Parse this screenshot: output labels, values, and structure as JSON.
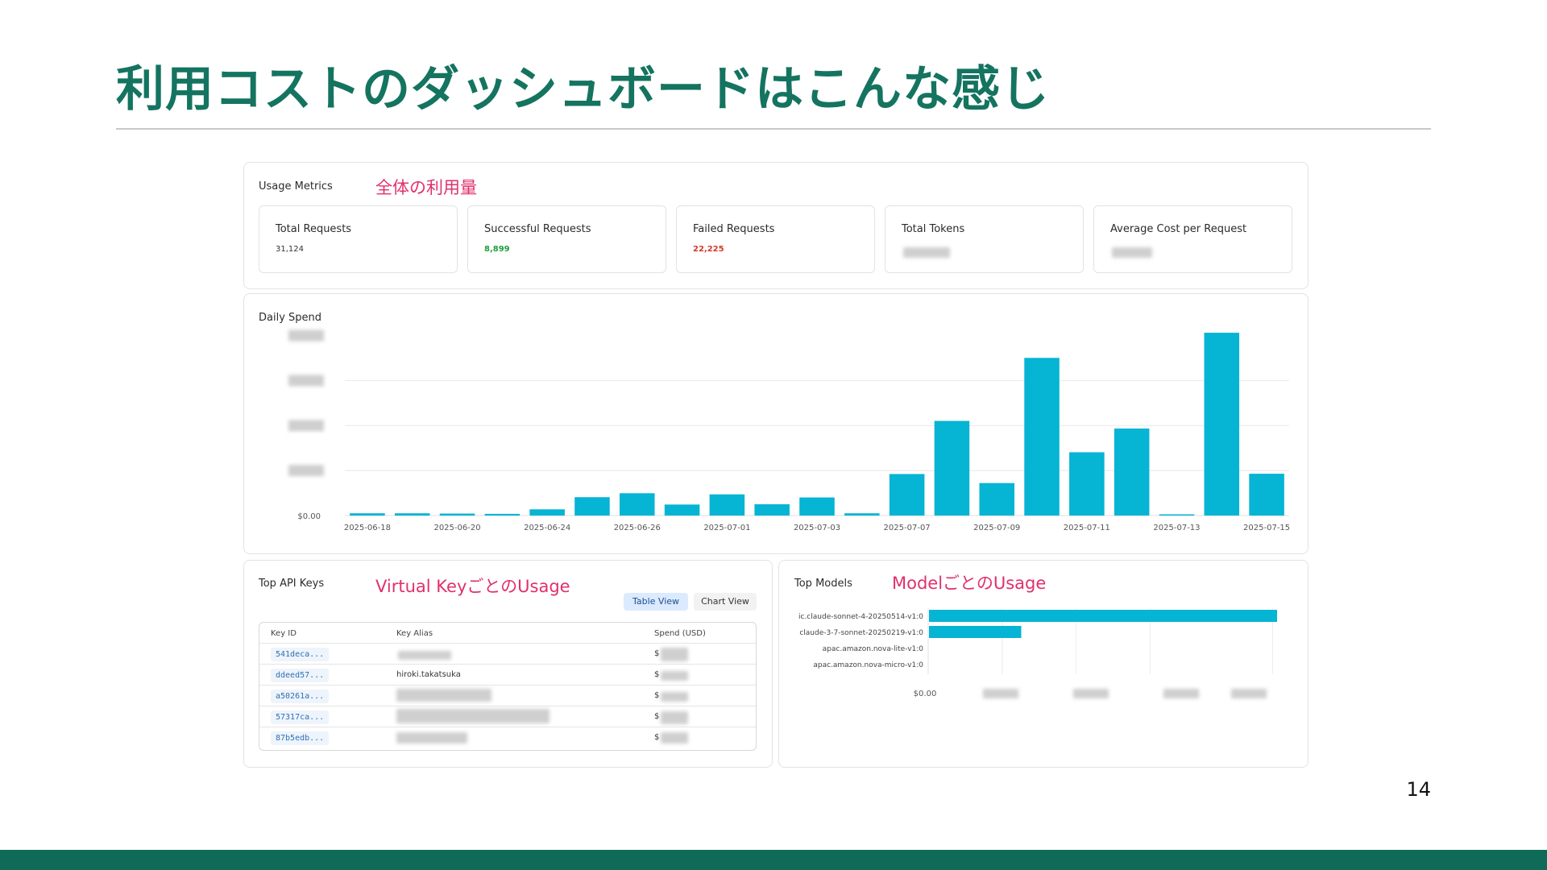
{
  "slide": {
    "title": "利用コストのダッシュボードはこんな感じ",
    "page_number": "14"
  },
  "colors": {
    "title": "#147460",
    "annotation": "#e1306c",
    "bar": "#06b4d4",
    "success": "#1f9d3a",
    "failed": "#d23a2a",
    "footer": "#0f6b58"
  },
  "usage_metrics": {
    "title": "Usage Metrics",
    "annotation": "全体の利用量",
    "cards": [
      {
        "label": "Total Requests",
        "value": "31,124",
        "tone": "neutral",
        "redacted": false
      },
      {
        "label": "Successful Requests",
        "value": "8,899",
        "tone": "success",
        "redacted": false
      },
      {
        "label": "Failed Requests",
        "value": "22,225",
        "tone": "failed",
        "redacted": false
      },
      {
        "label": "Total Tokens",
        "value": "",
        "tone": "neutral",
        "redacted": true
      },
      {
        "label": "Average Cost per Request",
        "value": "",
        "tone": "neutral",
        "redacted": true
      }
    ]
  },
  "daily_spend": {
    "title": "Daily Spend",
    "y_zero_label": "$0.00",
    "y_labels_redacted": true,
    "x_tick_labels": [
      "2025-06-18",
      "2025-06-20",
      "2025-06-24",
      "2025-06-26",
      "2025-07-01",
      "2025-07-03",
      "2025-07-07",
      "2025-07-09",
      "2025-07-11",
      "2025-07-13",
      "2025-07-15"
    ]
  },
  "chart_data": [
    {
      "type": "bar",
      "title": "Daily Spend",
      "x": [
        "2025-06-18",
        "2025-06-19",
        "2025-06-20",
        "2025-06-21",
        "2025-06-24",
        "2025-06-25",
        "2025-06-26",
        "2025-06-27",
        "2025-07-01",
        "2025-07-02",
        "2025-07-03",
        "2025-07-04",
        "2025-07-07",
        "2025-07-08",
        "2025-07-09",
        "2025-07-10",
        "2025-07-11",
        "2025-07-12",
        "2025-07-13",
        "2025-07-14",
        "2025-07-15"
      ],
      "values": [
        0.8,
        0.8,
        0.7,
        0.6,
        2.2,
        6.5,
        7.9,
        3.9,
        7.5,
        4.0,
        6.4,
        0.8,
        14.7,
        33.5,
        11.5,
        55.8,
        22.4,
        30.8,
        0.3,
        64.7,
        14.8
      ],
      "value_unit": "relative (y-axis labels redacted; ~4 gridlines of 16.3 each)",
      "ylim": [
        0,
        65
      ],
      "grid": true,
      "legend": "none"
    },
    {
      "type": "bar",
      "orientation": "horizontal",
      "title": "Top Models",
      "categories": [
        "ic.claude-sonnet-4-20250514-v1:0",
        "claude-3-7-sonnet-20250219-v1:0",
        "apac.amazon.nova-lite-v1:0",
        "apac.amazon.nova-micro-v1:0"
      ],
      "values": [
        100,
        26.5,
        0,
        0
      ],
      "value_unit": "relative (x-axis labels redacted)",
      "x_zero_label": "$0.00",
      "grid": true,
      "legend": "none"
    }
  ],
  "top_api_keys": {
    "title": "Top API Keys",
    "annotation": "Virtual KeyごとのUsage",
    "toggle": {
      "table_view": "Table View",
      "chart_view": "Chart View",
      "active": "table_view"
    },
    "columns": [
      "Key ID",
      "Key Alias",
      "Spend (USD)"
    ],
    "rows": [
      {
        "key_id": "541deca...",
        "alias": "",
        "alias_redacted": true,
        "spend_prefix": "$"
      },
      {
        "key_id": "ddeed57...",
        "alias": "hiroki.takatsuka",
        "alias_redacted": false,
        "spend_prefix": "$"
      },
      {
        "key_id": "a50261a...",
        "alias": "",
        "alias_redacted": true,
        "spend_prefix": "$"
      },
      {
        "key_id": "57317ca...",
        "alias": "",
        "alias_redacted": true,
        "spend_prefix": "$"
      },
      {
        "key_id": "87b5edb...",
        "alias": "",
        "alias_redacted": true,
        "spend_prefix": "$"
      }
    ]
  },
  "top_models": {
    "title": "Top Models",
    "annotation": "ModelごとのUsage"
  }
}
